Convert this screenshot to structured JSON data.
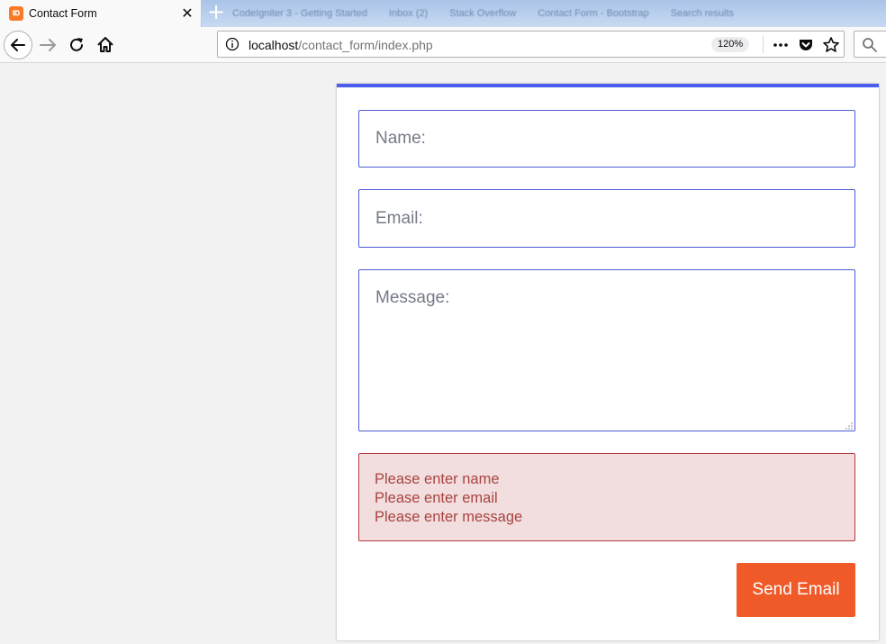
{
  "browser": {
    "active_tab": {
      "title": "Contact Form",
      "favicon": "xampp-icon"
    },
    "background_tabs": [
      "CodeIgniter 3 - Getting Started",
      "Inbox (2)",
      "Stack Overflow",
      "Contact Form - Bootstrap",
      "Search results"
    ],
    "url": {
      "host": "localhost",
      "path": "/contact_form/index.php"
    },
    "zoom": "120%"
  },
  "form": {
    "name_placeholder": "Name:",
    "email_placeholder": "Email:",
    "message_placeholder": "Message:",
    "errors": [
      "Please enter name",
      "Please enter email",
      "Please enter message"
    ],
    "submit_label": "Send Email"
  },
  "colors": {
    "card_top_border": "#4a5ef0",
    "field_border": "#4f5bd5",
    "error_bg": "#f2dede",
    "error_text": "#a94442",
    "button_bg": "#f05a28"
  }
}
